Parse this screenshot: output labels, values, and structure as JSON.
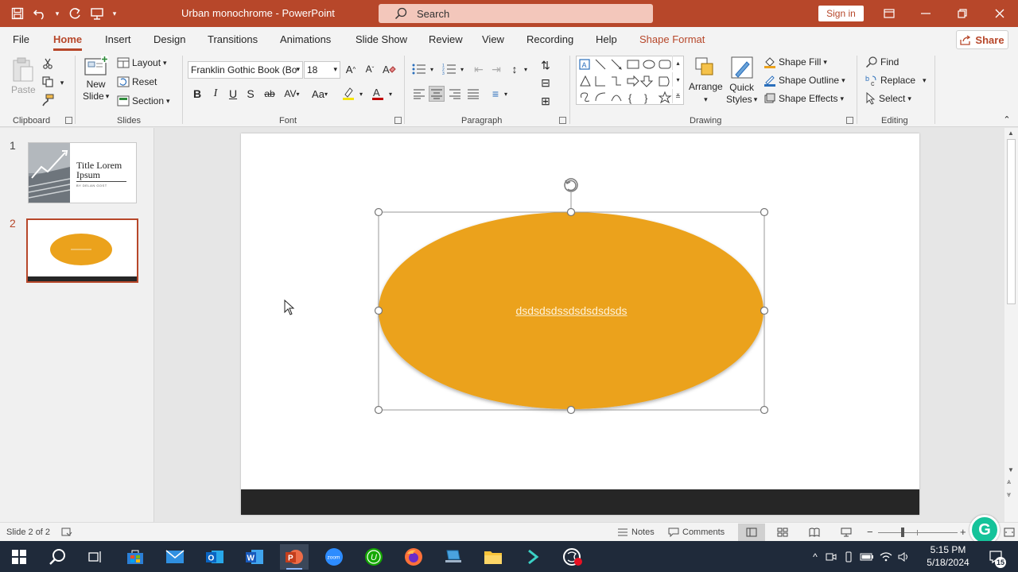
{
  "app": {
    "title": "Urban monochrome  -  PowerPoint",
    "search_placeholder": "Search",
    "sign_in": "Sign in",
    "accent": "#b7472a"
  },
  "tabs": [
    {
      "label": "File"
    },
    {
      "label": "Home"
    },
    {
      "label": "Insert"
    },
    {
      "label": "Design"
    },
    {
      "label": "Transitions"
    },
    {
      "label": "Animations"
    },
    {
      "label": "Slide Show"
    },
    {
      "label": "Review"
    },
    {
      "label": "View"
    },
    {
      "label": "Recording"
    },
    {
      "label": "Help"
    },
    {
      "label": "Shape Format"
    }
  ],
  "share_label": "Share",
  "ribbon": {
    "clipboard": {
      "label": "Clipboard",
      "paste": "Paste"
    },
    "slides": {
      "label": "Slides",
      "new_slide_1": "New",
      "new_slide_2": "Slide",
      "layout": "Layout",
      "reset": "Reset",
      "section": "Section"
    },
    "font": {
      "label": "Font",
      "font_name": "Franklin Gothic Book (Bo",
      "font_size": "18"
    },
    "paragraph": {
      "label": "Paragraph"
    },
    "drawing": {
      "label": "Drawing",
      "arrange": "Arrange",
      "quick_styles_1": "Quick",
      "quick_styles_2": "Styles",
      "shape_fill": "Shape Fill",
      "shape_outline": "Shape Outline",
      "shape_effects": "Shape Effects"
    },
    "editing": {
      "label": "Editing",
      "find": "Find",
      "replace": "Replace",
      "select": "Select"
    }
  },
  "thumbnails": [
    {
      "number": "1",
      "title_line1": "Title Lorem",
      "title_line2": "Ipsum",
      "subtitle": "BY DELAN GOST"
    },
    {
      "number": "2"
    }
  ],
  "slide": {
    "shape_text": "dsdsdsdssdsdsdsdsds",
    "shape_color": "#eba21c",
    "footer_color": "#262626"
  },
  "status": {
    "slide_counter": "Slide 2 of 2",
    "notes": "Notes",
    "comments": "Comments"
  },
  "taskbar": {
    "time": "5:15 PM",
    "date": "5/18/2024",
    "notification_count": "15"
  }
}
